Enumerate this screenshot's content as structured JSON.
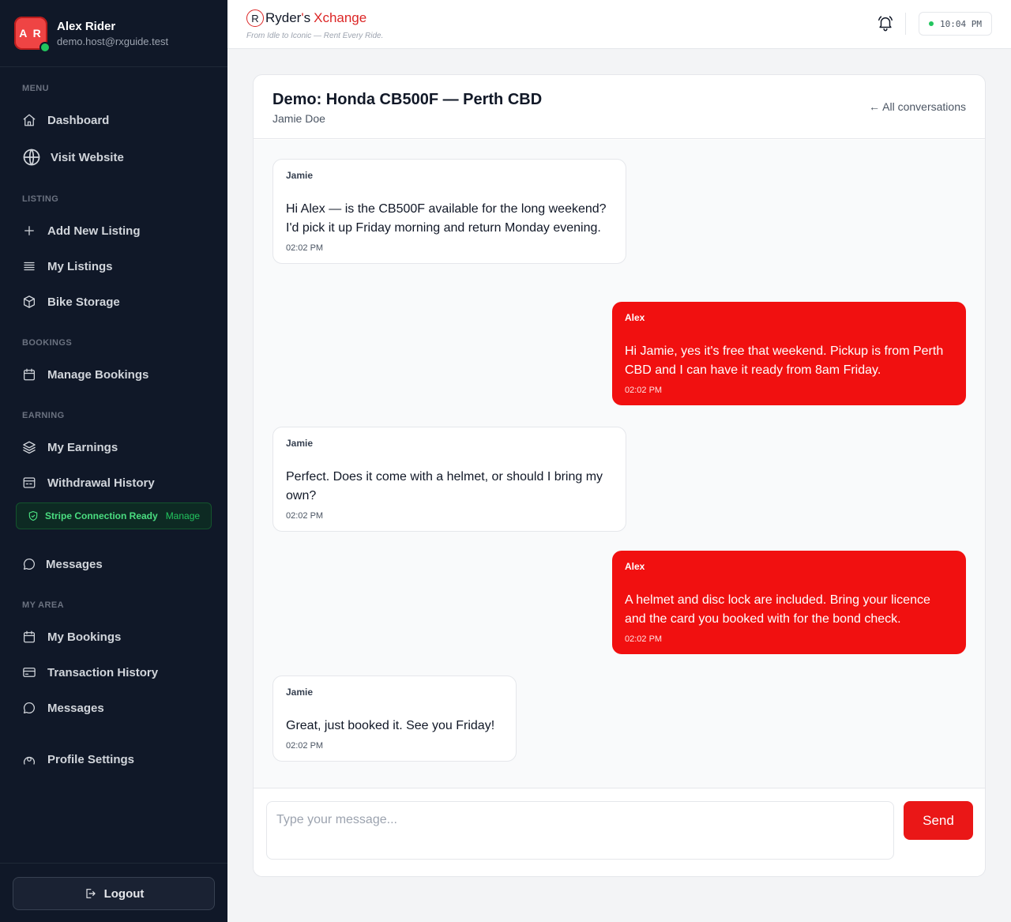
{
  "user": {
    "initials": "A R",
    "name": "Alex Rider",
    "email": "demo.host@rxguide.test"
  },
  "sidebar": {
    "menu_label": "MENU",
    "dashboard": "Dashboard",
    "visit_website": "Visit Website",
    "listing_label": "LISTING",
    "add_listing": "Add New Listing",
    "my_listings": "My Listings",
    "bike_storage": "Bike Storage",
    "bookings_label": "BOOKINGS",
    "manage_bookings": "Manage Bookings",
    "earning_label": "EARNING",
    "my_earnings": "My Earnings",
    "withdrawal_history": "Withdrawal History",
    "stripe_status": "Stripe Connection Ready",
    "stripe_manage": "Manage",
    "messages_host": "Messages",
    "my_area_label": "MY AREA",
    "my_bookings": "My Bookings",
    "transaction_history": "Transaction History",
    "messages_area": "Messages",
    "profile_settings": "Profile Settings",
    "logout": "Logout"
  },
  "header": {
    "brand_mark": "R",
    "brand_main": "Ryder",
    "brand_apos": "'",
    "brand_s": "s",
    "brand_accent": "Xchange",
    "tagline": "From Idle to Iconic — Rent Every Ride.",
    "clock": "10:04 PM"
  },
  "conversation": {
    "title": "Demo: Honda CB500F — Perth CBD",
    "subtitle": "Jamie Doe",
    "back_link": "← All conversations",
    "messages": [
      {
        "sender": "Jamie",
        "side": "them",
        "text": "Hi Alex — is the CB500F available for the long weekend? I'd pick it up Friday morning and return Monday evening.",
        "time": "02:02 PM"
      },
      {
        "sender": "Alex",
        "side": "me",
        "text": "Hi Jamie, yes it's free that weekend. Pickup is from Perth CBD and I can have it ready from 8am Friday.",
        "time": "02:02 PM"
      },
      {
        "sender": "Jamie",
        "side": "them",
        "text": "Perfect. Does it come with a helmet, or should I bring my own?",
        "time": "02:02 PM"
      },
      {
        "sender": "Alex",
        "side": "me",
        "text": "A helmet and disc lock are included. Bring your licence and the card you booked with for the bond check.",
        "time": "02:02 PM"
      },
      {
        "sender": "Jamie",
        "side": "them",
        "text": "Great, just booked it. See you Friday!",
        "time": "02:02 PM"
      }
    ]
  },
  "composer": {
    "placeholder": "Type your message...",
    "value": "",
    "send_label": "Send"
  },
  "colors": {
    "sidebar_bg": "#101828",
    "accent_red": "#f11010",
    "online_green": "#22c55e"
  }
}
